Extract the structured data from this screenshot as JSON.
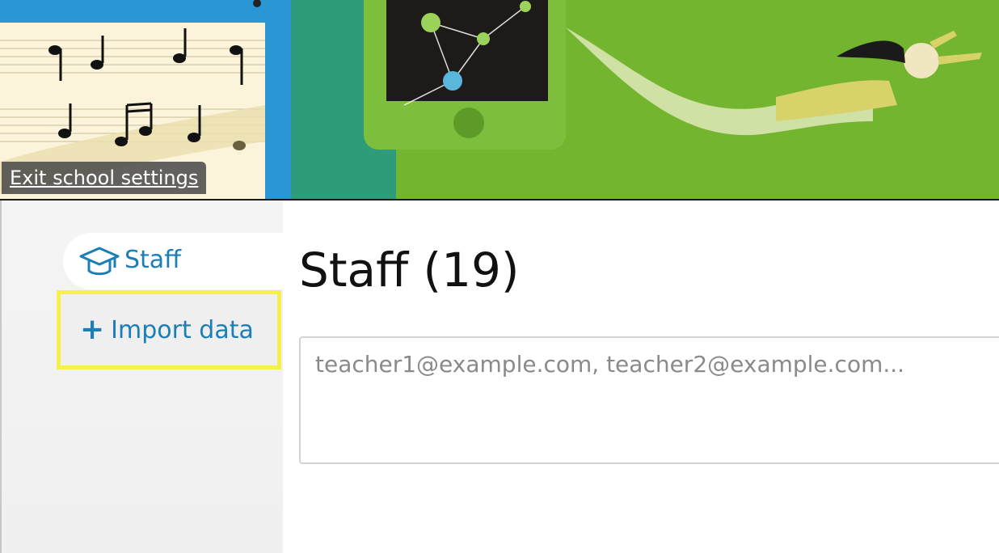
{
  "banner": {
    "exit_label": "Exit school settings"
  },
  "sidebar": {
    "items": [
      {
        "label": "Staff",
        "icon": "graduation-cap-icon",
        "active": true
      },
      {
        "label": "Import data",
        "icon": "plus-icon",
        "highlighted": true
      }
    ]
  },
  "main": {
    "title": "Staff (19)",
    "email_input": {
      "placeholder": "teacher1@example.com, teacher2@example.com...",
      "value": ""
    }
  },
  "colors": {
    "accent": "#1b7fb6",
    "highlight": "#f5f14a",
    "banner_green": "#6cb42c"
  }
}
